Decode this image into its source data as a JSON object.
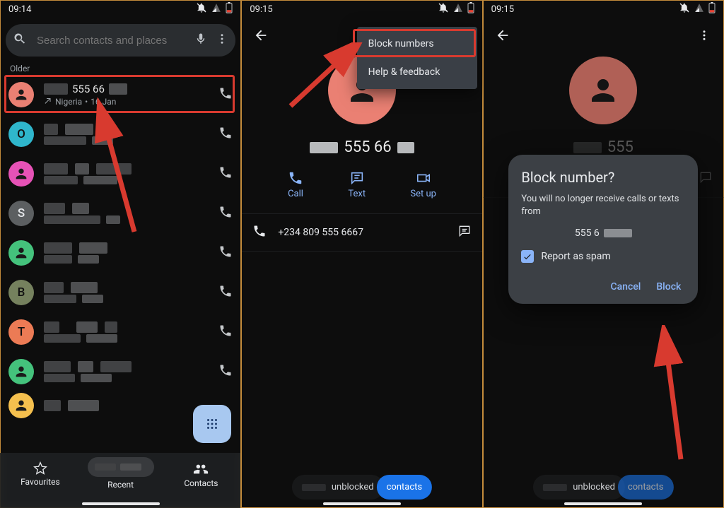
{
  "panel1": {
    "time": "09:14",
    "search_placeholder": "Search contacts and places",
    "section_older": "Older",
    "entries": [
      {
        "number_prefix": "555 66",
        "meta_loc": "Nigeria",
        "meta_sep": "•",
        "meta_date": "16 Jan",
        "avatar_type": "person",
        "avatar_color": "#ea8073"
      },
      {
        "letter": "O",
        "avatar_color": "#2fb6cc"
      },
      {
        "avatar_type": "person",
        "avatar_color": "#e652b6"
      },
      {
        "letter": "S",
        "avatar_color": "#5c5f61"
      },
      {
        "avatar_type": "person",
        "avatar_color": "#44c27c"
      },
      {
        "letter": "B",
        "avatar_color": "#75815e"
      },
      {
        "letter": "T",
        "avatar_color": "#ec7b55"
      },
      {
        "avatar_type": "person",
        "avatar_color": "#44c27c"
      },
      {
        "avatar_type": "person",
        "avatar_color": "#f5c04e"
      }
    ],
    "nav": {
      "fav": "Favourites",
      "recent": "Recent",
      "contacts": "Contacts"
    }
  },
  "panel2": {
    "time": "09:15",
    "menu": {
      "block": "Block numbers",
      "help": "Help & feedback"
    },
    "number_fragment": "555 66",
    "actions": {
      "call": "Call",
      "text": "Text",
      "setup": "Set up"
    },
    "full_number": "+234 809 555 6667",
    "snack_text": "unblocked",
    "chip_text": "contacts"
  },
  "panel3": {
    "time": "09:15",
    "number_fragment": "555",
    "dialog": {
      "title": "Block number?",
      "body": "You will no longer receive calls or texts from",
      "num_fragment": "555 6",
      "report": "Report as spam",
      "cancel": "Cancel",
      "block": "Block"
    },
    "snack_text": "unblocked",
    "chip_text": "contacts"
  }
}
